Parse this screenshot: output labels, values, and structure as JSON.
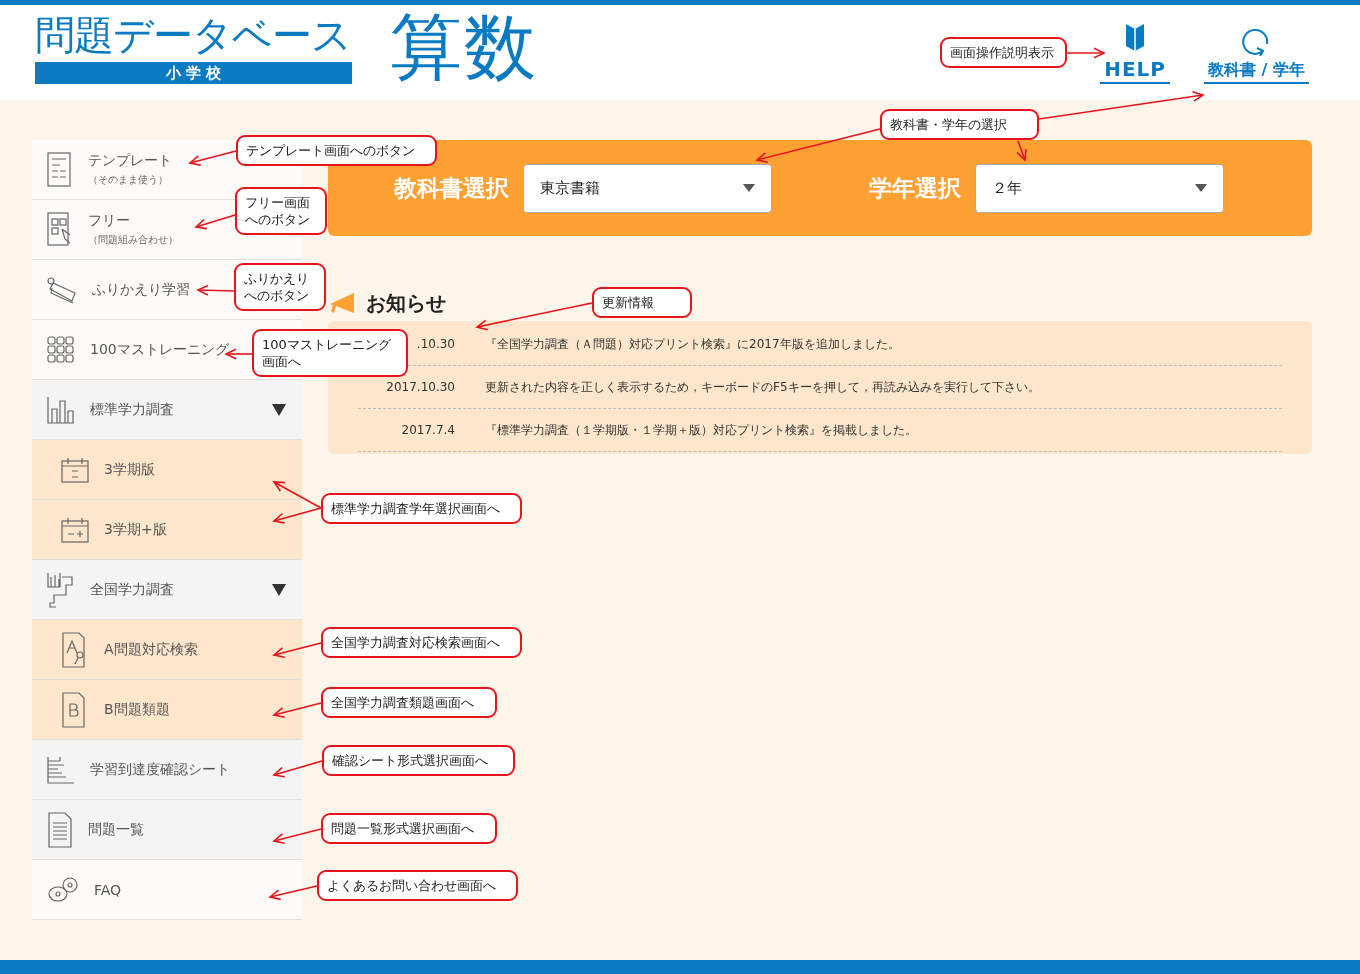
{
  "header": {
    "title": "問題データベース",
    "subtitle": "小 学 校",
    "subject": "算数",
    "help": "HELP",
    "textbook_link": "教科書 / 学年"
  },
  "sidebar": {
    "items": [
      {
        "label": "テンプレート",
        "sublabel": "（そのまま使う）",
        "kind": "plain"
      },
      {
        "label": "フリー",
        "sublabel": "（問題組み合わせ）",
        "kind": "plain"
      },
      {
        "label": "ふりかえり学習",
        "kind": "plain"
      },
      {
        "label": "100マストレーニング",
        "kind": "plain"
      },
      {
        "label": "標準学力調査",
        "kind": "shaded",
        "expanded": true,
        "children": [
          {
            "label": "3学期版"
          },
          {
            "label": "3学期+版"
          }
        ]
      },
      {
        "label": "全国学力調査",
        "kind": "shaded",
        "expanded": true,
        "children": [
          {
            "label": "A問題対応検索"
          },
          {
            "label": "B問題類題"
          }
        ]
      },
      {
        "label": "学習到達度確認シート",
        "kind": "shaded"
      },
      {
        "label": "問題一覧",
        "kind": "shaded"
      },
      {
        "label": "FAQ",
        "kind": "plain"
      }
    ]
  },
  "selectors": [
    {
      "label": "教科書選択",
      "value": "東京書籍"
    },
    {
      "label": "学年選択",
      "value": "２年"
    }
  ],
  "news": {
    "title": "お知らせ",
    "items": [
      {
        "date": ".10.30",
        "text": "『全国学力調査（Ａ問題）対応プリント検索』に2017年版を追加しました。"
      },
      {
        "date": "2017.10.30",
        "text": "更新された内容を正しく表示するため，キーボードのF5キーを押して，再読み込みを実行して下さい。"
      },
      {
        "date": "2017.7.4",
        "text": "『標準学力調査（１学期版・１学期＋版）対応プリント検索』を掲載しました。"
      }
    ]
  },
  "annotations": [
    "画面操作説明表示",
    "教科書・学年の選択",
    "テンプレート画面へのボタン",
    "フリー画面へのボタン",
    "ふりかえりへのボタン",
    "更新情報",
    "100マストレーニング画面へ",
    "標準学力調査学年選択画面へ",
    "全国学力調査対応検索画面へ",
    "全国学力調査類題画面へ",
    "確認シート形式選択画面へ",
    "問題一覧形式選択画面へ",
    "よくあるお問い合わせ画面へ"
  ]
}
